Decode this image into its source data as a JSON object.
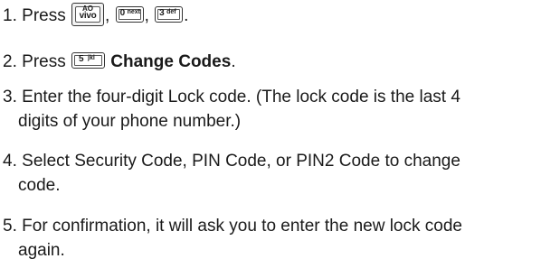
{
  "steps": [
    {
      "number": "1.",
      "prefix": "Press",
      "keys": [
        {
          "line1": "AO",
          "line2": "vivo"
        },
        {
          "num": "0",
          "sub": "next"
        },
        {
          "num": "3",
          "sub": "def"
        }
      ],
      "separator": ",",
      "end": "."
    },
    {
      "number": "2.",
      "prefix": "Press",
      "key": {
        "num": "5",
        "sub": "jkl"
      },
      "label": "Change Codes",
      "end": "."
    },
    {
      "number": "3.",
      "line1": "Enter the four-digit Lock code. (The lock code is the last 4",
      "line2": "digits of your phone number.)"
    },
    {
      "number": "4.",
      "line1": "Select Security Code, PIN Code, or PIN2 Code to change",
      "line2": "code."
    },
    {
      "number": "5.",
      "line1": "For confirmation, it will ask you to enter the new lock code",
      "line2": "again."
    }
  ]
}
